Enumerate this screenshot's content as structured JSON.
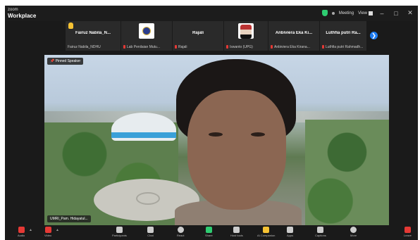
{
  "app": {
    "brand_top": "zoom",
    "brand_main": "Workplace"
  },
  "titlebar": {
    "meeting": "Meeting",
    "view": "View"
  },
  "participants": [
    {
      "name": "Fairuz  Nabila_N...",
      "sub": "Fairuz Nabila_NDHU",
      "raised_hand": true,
      "muted": false
    },
    {
      "name": "",
      "sub": "Lab Penilaian Mutu...",
      "avatar": "institution-logo",
      "muted": true
    },
    {
      "name": "Rajali",
      "sub": "Rajali",
      "muted": true
    },
    {
      "name": "",
      "sub": "Iswanto (UPG)",
      "avatar": "photo",
      "muted": true
    },
    {
      "name": "Anbiviera Eka Ki...",
      "sub": "Anbiviera Eka Kirana...",
      "muted": true
    },
    {
      "name": "Luthfia putri Ra...",
      "sub": "Luthfia putri Rahmadh...",
      "muted": true
    }
  ],
  "main_video": {
    "pin_label": "Pinned Speaker",
    "name_label": "UMRI_Pam. Hidayatul..."
  },
  "toolbar": [
    {
      "label": "Audio",
      "icon": "mic-muted-icon",
      "color": "#e53935"
    },
    {
      "label": "Video",
      "icon": "video-off-icon",
      "color": "#e53935"
    },
    {
      "label": "Participants",
      "icon": "participants-icon",
      "color": "#cccccc"
    },
    {
      "label": "Chat",
      "icon": "chat-icon",
      "color": "#cccccc"
    },
    {
      "label": "React",
      "icon": "react-icon",
      "color": "#cccccc"
    },
    {
      "label": "Share",
      "icon": "share-icon",
      "color": "#2ecc71"
    },
    {
      "label": "Host tools",
      "icon": "shield-icon",
      "color": "#cccccc"
    },
    {
      "label": "AI Companion",
      "icon": "ai-companion-icon",
      "color": "#f6c233"
    },
    {
      "label": "Apps",
      "icon": "apps-icon",
      "color": "#cccccc"
    },
    {
      "label": "Captions",
      "icon": "captions-icon",
      "color": "#cccccc"
    },
    {
      "label": "More",
      "icon": "more-icon",
      "color": "#cccccc"
    },
    {
      "label": "Leave",
      "icon": "leave-icon",
      "color": "#e53935"
    }
  ]
}
